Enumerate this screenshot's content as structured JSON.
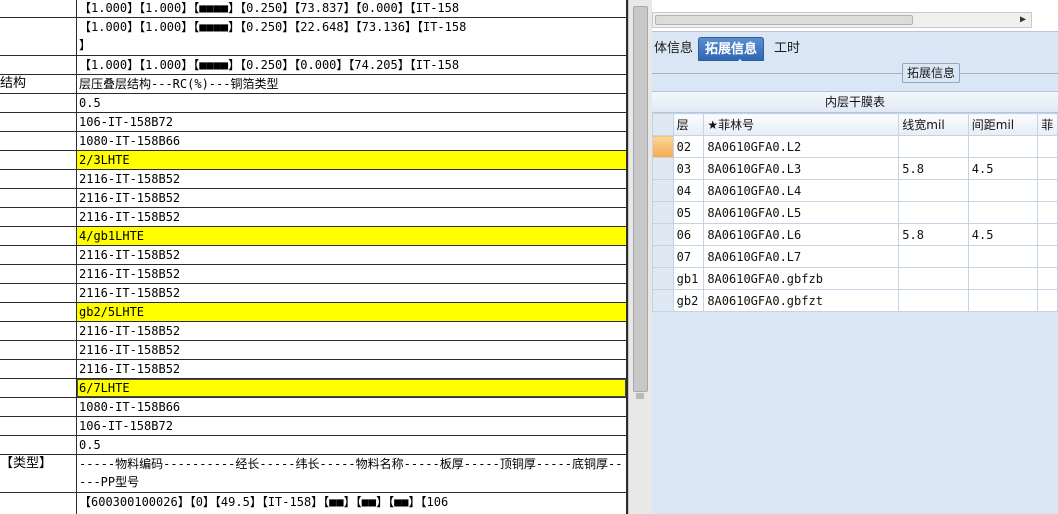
{
  "left_sheet": {
    "rows": [
      {
        "a": "",
        "b": "【1.000】【1.000】【■■■■】【0.250】【73.837】【0.000】【IT-158",
        "hl": false
      },
      {
        "a": "",
        "b": "【1.000】【1.000】【■■■■】【0.250】【22.648】【73.136】【IT-158\n】",
        "hl": false
      },
      {
        "a": "",
        "b": "【1.000】【1.000】【■■■■】【0.250】【0.000】【74.205】【IT-158",
        "hl": false
      },
      {
        "a": "结构",
        "b": "层压叠层结构---RC(%)---铜箔类型",
        "hl": false
      },
      {
        "a": "",
        "b": "0.5",
        "hl": false
      },
      {
        "a": "",
        "b": "106-IT-158B72",
        "hl": false
      },
      {
        "a": "",
        "b": "1080-IT-158B66",
        "hl": false
      },
      {
        "a": "",
        "b": "2/3LHTE",
        "hl": true
      },
      {
        "a": "",
        "b": "2116-IT-158B52",
        "hl": false
      },
      {
        "a": "",
        "b": "2116-IT-158B52",
        "hl": false
      },
      {
        "a": "",
        "b": "2116-IT-158B52",
        "hl": false
      },
      {
        "a": "",
        "b": "4/gb1LHTE",
        "hl": true
      },
      {
        "a": "",
        "b": "2116-IT-158B52",
        "hl": false
      },
      {
        "a": "",
        "b": "2116-IT-158B52",
        "hl": false
      },
      {
        "a": "",
        "b": "2116-IT-158B52",
        "hl": false
      },
      {
        "a": "",
        "b": "gb2/5LHTE",
        "hl": true
      },
      {
        "a": "",
        "b": "2116-IT-158B52",
        "hl": false
      },
      {
        "a": "",
        "b": "2116-IT-158B52",
        "hl": false
      },
      {
        "a": "",
        "b": "2116-IT-158B52",
        "hl": false
      },
      {
        "a": "",
        "b": "6/7LHTE",
        "hl": true
      },
      {
        "a": "",
        "b": "1080-IT-158B66",
        "hl": false
      },
      {
        "a": "",
        "b": "106-IT-158B72",
        "hl": false
      },
      {
        "a": "",
        "b": "0.5",
        "hl": false
      },
      {
        "a": "【类型】",
        "b": "-----物料编码----------经长-----纬长-----物料名称-----板厚-----顶铜厚-----底铜厚-----PP型号",
        "hl": false
      },
      {
        "a": "",
        "b": "【600300100026】【0】【49.5】【IT-158】【■■】【■■】【■■】【106",
        "hl": false
      }
    ]
  },
  "tabs": [
    {
      "label": "体信息",
      "active": false
    },
    {
      "label": "拓展信息",
      "active": true
    },
    {
      "label": "工时",
      "active": false
    }
  ],
  "section_title": "拓展信息",
  "grid": {
    "caption": "内层干膜表",
    "columns": [
      "层",
      "★菲林号",
      "线宽mil",
      "间距mil",
      "菲"
    ],
    "rows": [
      [
        "02",
        "8A0610GFA0.L2",
        "",
        "",
        ""
      ],
      [
        "03",
        "8A0610GFA0.L3",
        "5.8",
        "4.5",
        ""
      ],
      [
        "04",
        "8A0610GFA0.L4",
        "",
        "",
        ""
      ],
      [
        "05",
        "8A0610GFA0.L5",
        "",
        "",
        ""
      ],
      [
        "06",
        "8A0610GFA0.L6",
        "5.8",
        "4.5",
        ""
      ],
      [
        "07",
        "8A0610GFA0.L7",
        "",
        "",
        ""
      ],
      [
        "gb1",
        "8A0610GFA0.gbfzb",
        "",
        "",
        ""
      ],
      [
        "gb2",
        "8A0610GFA0.gbfzt",
        "",
        "",
        ""
      ]
    ],
    "current_row": 0
  },
  "colors": {
    "highlight": "#ffff00",
    "panel_bg": "#dbe6f4",
    "tab_active": "#2f67b4",
    "row_indicator": "#f5a94d"
  },
  "icons": [
    "scroll-right-arrow-icon",
    "row-indicator-icon"
  ]
}
